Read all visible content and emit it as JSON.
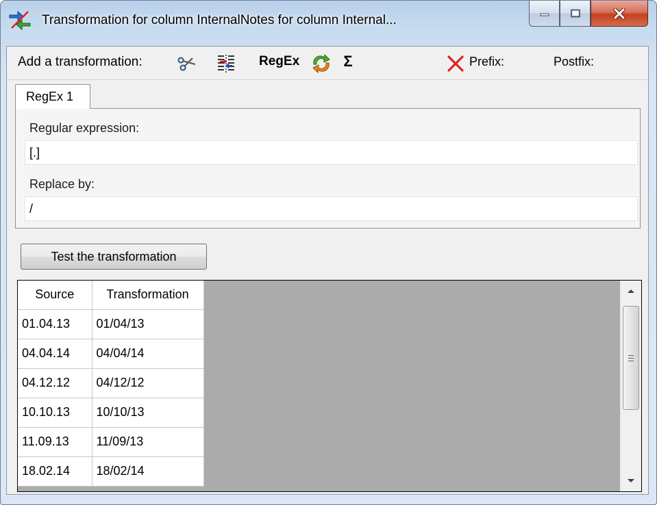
{
  "window": {
    "title": "Transformation for column InternalNotes for column Internal..."
  },
  "icons": {
    "app": "transform-arrows-icon",
    "minimize": "minimize-icon",
    "maximize": "maximize-icon",
    "close": "close-icon",
    "cut": "scissors-icon",
    "split": "split-columns-icon",
    "convert": "convert-arrows-icon",
    "sum": "sigma-icon",
    "delete": "red-x-icon"
  },
  "toolbar": {
    "label": "Add a transformation:",
    "regex": "RegEx",
    "sum_symbol": "Σ",
    "prefix": "Prefix:",
    "postfix": "Postfix:"
  },
  "tab": {
    "label": "RegEx 1"
  },
  "form": {
    "regex_label": "Regular expression:",
    "regex_value": "[.]",
    "replace_label": "Replace by:",
    "replace_value": "/"
  },
  "test_button": "Test the transformation",
  "grid": {
    "columns": [
      "Source",
      "Transformation"
    ],
    "rows": [
      [
        "01.04.13",
        "01/04/13"
      ],
      [
        "04.04.14",
        "04/04/14"
      ],
      [
        "04.12.12",
        "04/12/12"
      ],
      [
        "10.10.13",
        "10/10/13"
      ],
      [
        "11.09.13",
        "11/09/13"
      ],
      [
        "18.02.14",
        "18/02/14"
      ]
    ]
  },
  "colors": {
    "accent_blue": "#c6dbef",
    "close_red": "#c4401f",
    "delete_red": "#e02020",
    "grid_background": "#ababab"
  }
}
